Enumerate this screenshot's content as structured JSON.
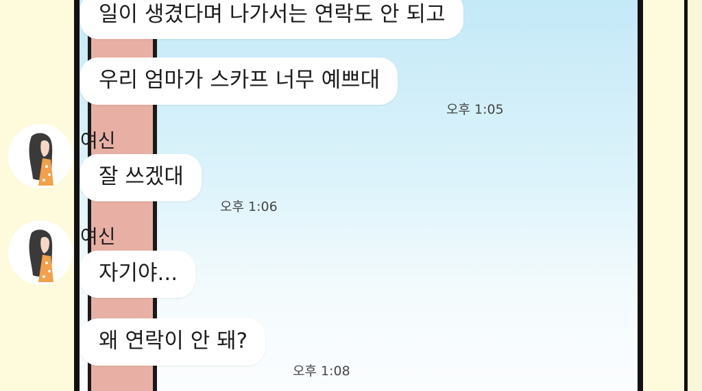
{
  "chat": {
    "messages": [
      {
        "text": "일이 생겼다며 나가서는 연락도 안 되고"
      },
      {
        "text": "우리 엄마가 스카프 너무 예쁘대",
        "time": "오후 1:05"
      },
      {
        "sender": "여신",
        "text": "잘 쓰겠대",
        "time": "오후 1:06"
      },
      {
        "sender": "여신",
        "text": "자기야..."
      },
      {
        "text": "왜 연락이 안 돼?",
        "time": "오후 1:08"
      }
    ]
  },
  "avatar": {
    "icon": "girl-avatar-icon"
  },
  "colors": {
    "background": "#fdfbdc",
    "bubble": "#ffffff",
    "curtain": "#e8b0a4",
    "sky": "#c4e9f7"
  }
}
